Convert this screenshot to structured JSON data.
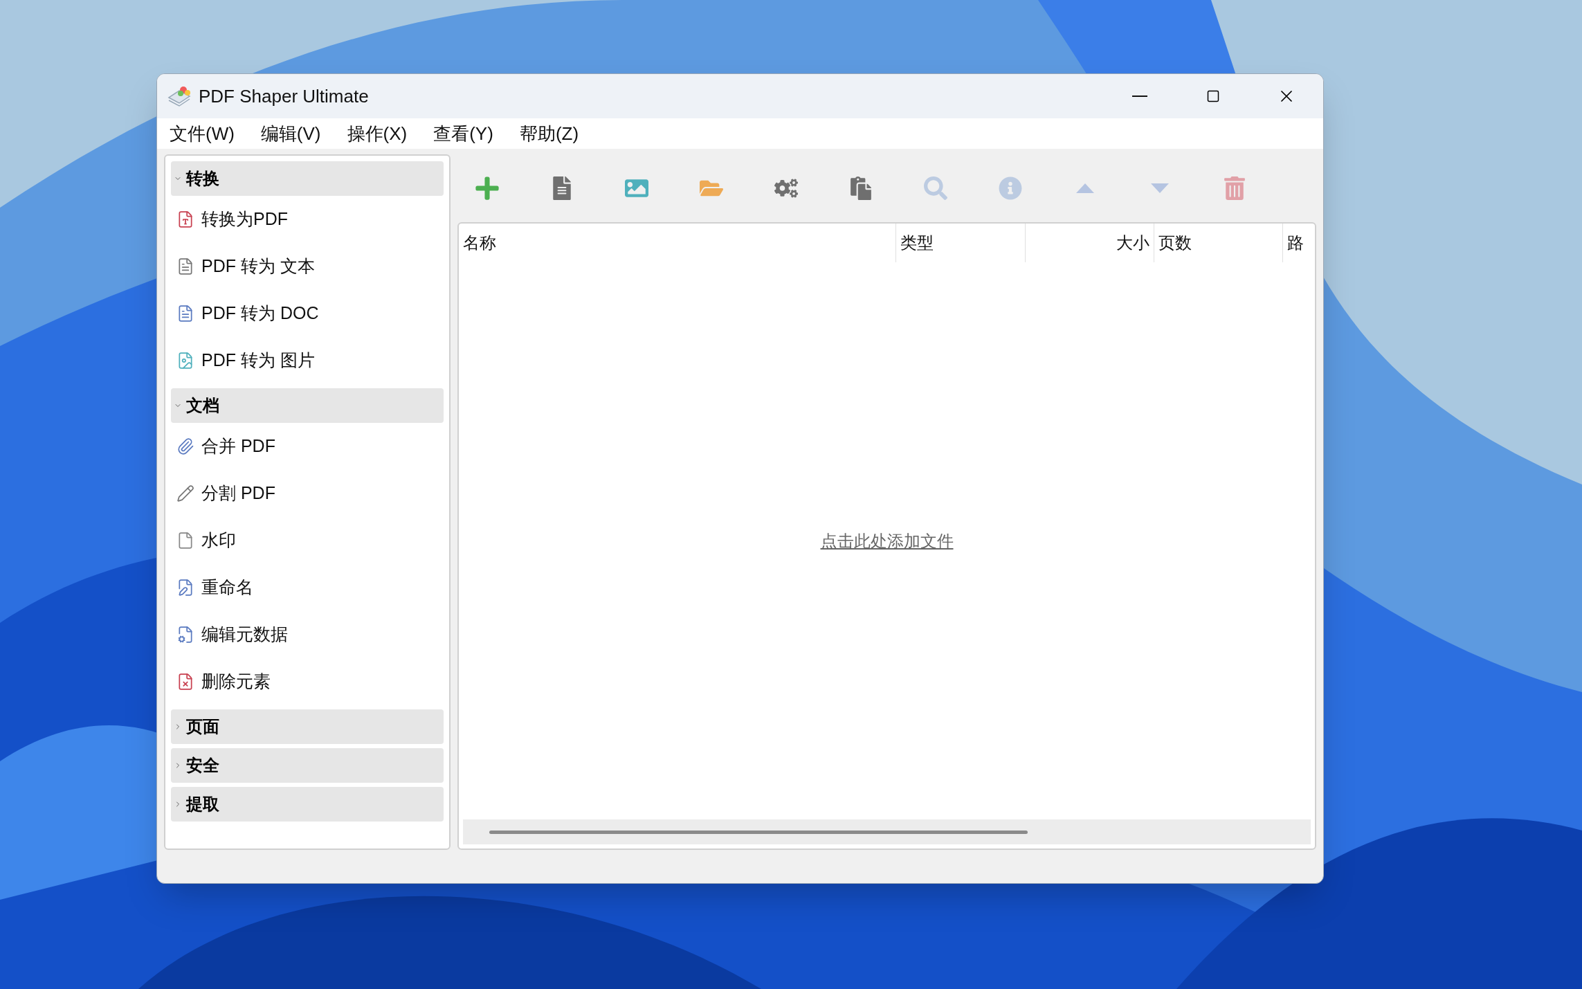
{
  "window": {
    "title": "PDF Shaper Ultimate"
  },
  "menu": [
    {
      "label": "文件(W)"
    },
    {
      "label": "编辑(V)"
    },
    {
      "label": "操作(X)"
    },
    {
      "label": "查看(Y)"
    },
    {
      "label": "帮助(Z)"
    }
  ],
  "sidebar": {
    "groups": [
      {
        "label": "转换",
        "expanded": true,
        "items": [
          {
            "label": "转换为PDF"
          },
          {
            "label": "PDF 转为 文本"
          },
          {
            "label": "PDF 转为 DOC"
          },
          {
            "label": "PDF 转为 图片"
          }
        ]
      },
      {
        "label": "文档",
        "expanded": true,
        "items": [
          {
            "label": "合并 PDF"
          },
          {
            "label": "分割 PDF"
          },
          {
            "label": "水印"
          },
          {
            "label": "重命名"
          },
          {
            "label": "编辑元数据"
          },
          {
            "label": "删除元素"
          }
        ]
      },
      {
        "label": "页面",
        "expanded": false
      },
      {
        "label": "安全",
        "expanded": false
      },
      {
        "label": "提取",
        "expanded": false
      }
    ]
  },
  "toolbar": [
    {
      "disabled": false
    },
    {
      "disabled": false
    },
    {
      "disabled": false
    },
    {
      "disabled": false
    },
    {
      "disabled": false
    },
    {
      "disabled": false
    },
    {
      "disabled": true
    },
    {
      "disabled": true
    },
    {
      "disabled": true
    },
    {
      "disabled": true
    },
    {
      "disabled": true
    }
  ],
  "table": {
    "columns": [
      {
        "label": "名称"
      },
      {
        "label": "类型"
      },
      {
        "label": "大小"
      },
      {
        "label": "页数"
      },
      {
        "label": "路"
      }
    ],
    "empty_hint": "点击此处添加文件"
  }
}
